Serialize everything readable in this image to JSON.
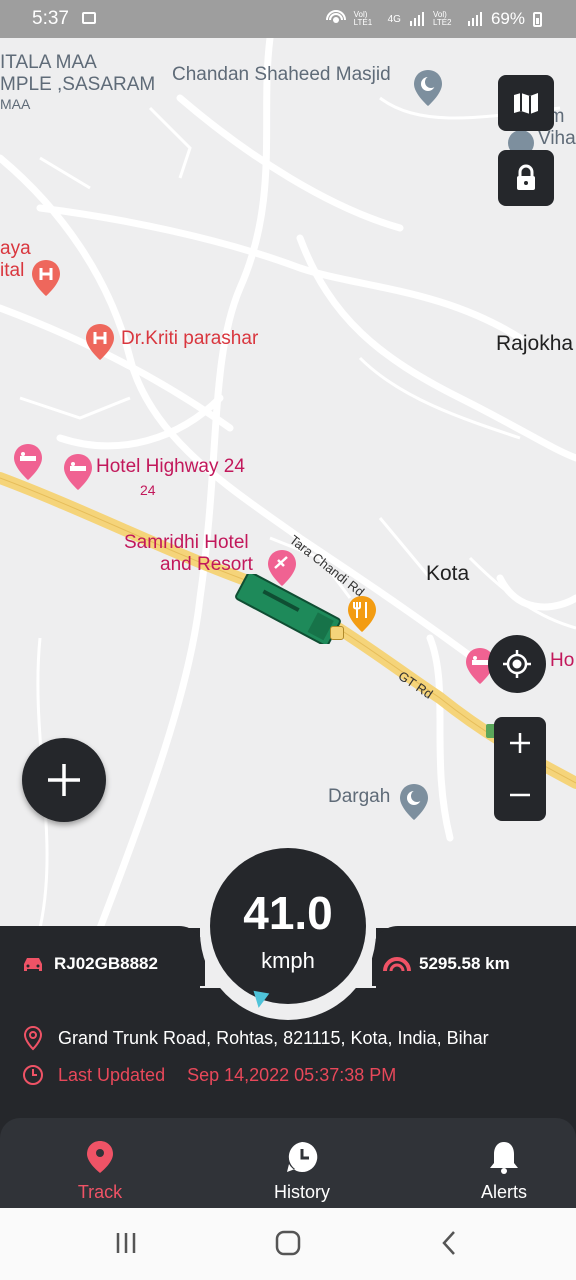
{
  "status_bar": {
    "time": "5:37",
    "net1": "Vol) LTE1",
    "net_4g": "4G",
    "net2": "Vol) LTE2",
    "battery": "69%"
  },
  "map": {
    "labels": {
      "temple_line1": "ITALA MAA",
      "temple_line2": "MPLE ,SASARAM",
      "temple_line3": "MAA",
      "masjid": "Chandan Shaheed Masjid",
      "vihar_line1": "am",
      "vihar_line2": "Viha",
      "hospital_line1": "aya",
      "hospital_line2": "ital",
      "doctor": "Dr.Kriti parashar",
      "rajokhar": "Rajokha",
      "hotel_highway": "Hotel Highway 24",
      "hotel_highway_sub": "24",
      "samridhi_line1": "Samridhi Hotel",
      "samridhi_line2": "and Resort",
      "tara_chandi": "Tara Chandi Rd",
      "kota": "Kota",
      "gt_rd": "GT Rd",
      "ho": "Ho",
      "dargah": "Dargah"
    }
  },
  "speedometer": {
    "value": "41.0",
    "unit": "kmph"
  },
  "vehicle": {
    "plate": "RJ02GB8882",
    "odometer": "5295.58 km",
    "address": "Grand Trunk Road, Rohtas, 821115, Kota, India, Bihar",
    "last_updated_label": "Last Updated",
    "last_updated_value": "Sep 14,2022 05:37:38 PM"
  },
  "bottom_nav": {
    "track": "Track",
    "history": "History",
    "alerts": "Alerts"
  },
  "colors": {
    "panel": "#25272b",
    "accent": "#ef5366",
    "road": "#f5d47a",
    "vehicle": "#1e8a5a"
  }
}
